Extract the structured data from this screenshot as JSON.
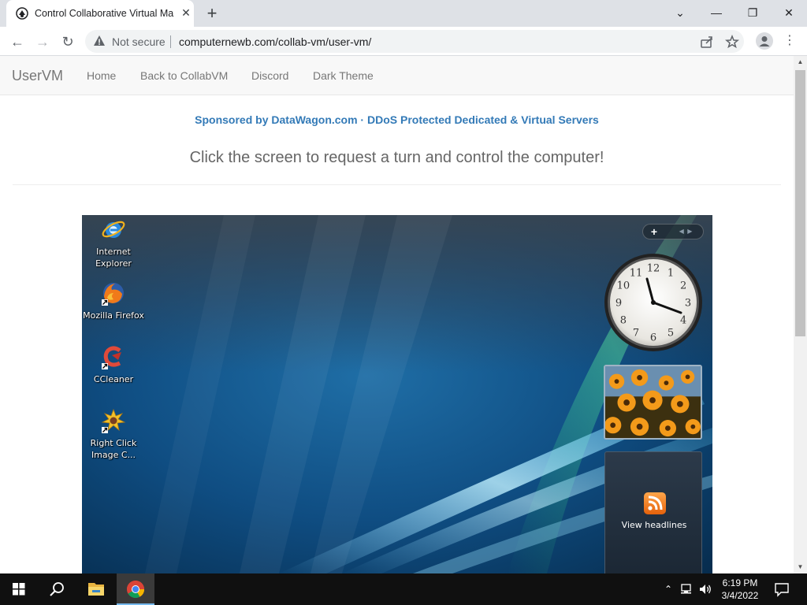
{
  "browser": {
    "tab_title": "Control Collaborative Virtual Ma",
    "security_label": "Not secure",
    "url": "computernewb.com/collab-vm/user-vm/"
  },
  "navbar": {
    "brand": "UserVM",
    "links": [
      "Home",
      "Back to CollabVM",
      "Discord",
      "Dark Theme"
    ]
  },
  "page": {
    "sponsor": "Sponsored by DataWagon.com · DDoS Protected Dedicated & Virtual Servers",
    "headline": "Click the screen to request a turn and control the computer!"
  },
  "vm_desktop": {
    "icons": [
      {
        "label_lines": [
          "Internet",
          "Explorer"
        ],
        "icon": "internet-explorer-icon"
      },
      {
        "label_lines": [
          "Mozilla Firefox"
        ],
        "icon": "firefox-icon"
      },
      {
        "label_lines": [
          "CCleaner"
        ],
        "icon": "ccleaner-icon"
      },
      {
        "label_lines": [
          "Right Click",
          "Image C..."
        ],
        "icon": "right-click-image-icon"
      }
    ],
    "clock_numbers": [
      "12",
      "1",
      "2",
      "3",
      "4",
      "5",
      "6",
      "7",
      "8",
      "9",
      "10",
      "11"
    ],
    "feed_label": "View headlines"
  },
  "taskbar": {
    "time": "6:19 PM",
    "date": "3/4/2022"
  }
}
